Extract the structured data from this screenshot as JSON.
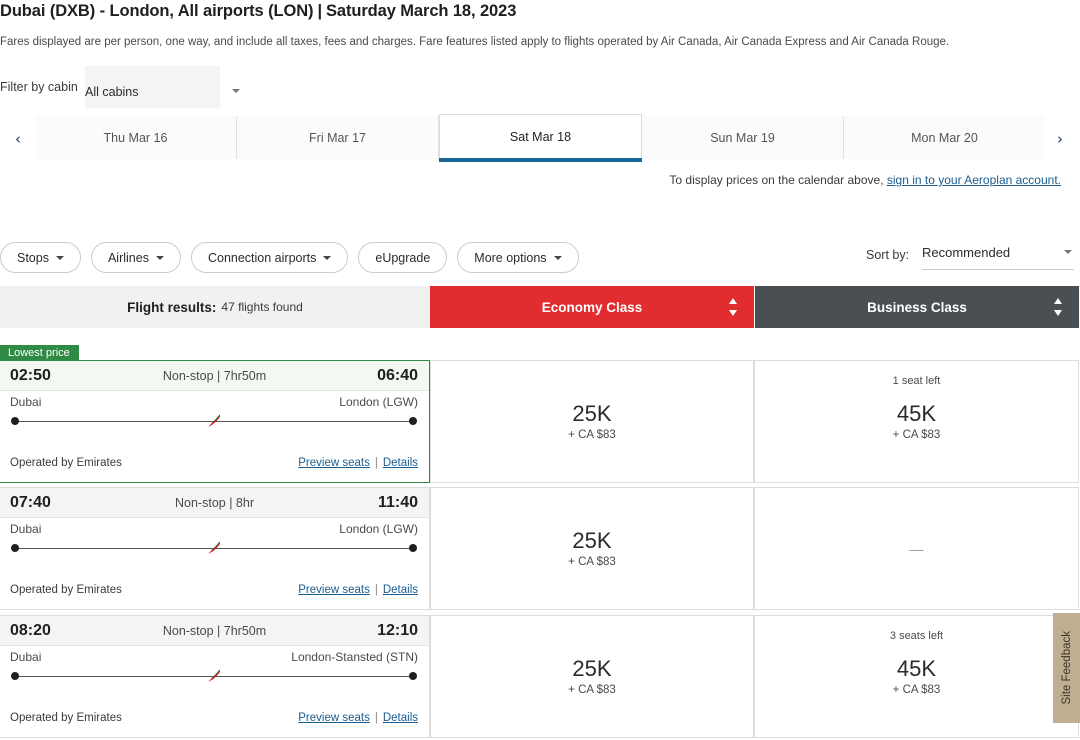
{
  "header": {
    "route": "Dubai (DXB) - London, All airports (LON)",
    "separator": "|",
    "date": "Saturday March 18, 2023",
    "fare_note": "Fares displayed are per person, one way, and include all taxes, fees and charges. Fare features listed apply to flights operated by Air Canada, Air Canada Express and Air Canada Rouge."
  },
  "cabin_filter": {
    "label": "Filter by cabin",
    "value": "All cabins"
  },
  "date_strip": {
    "prev_icon": "‹",
    "next_icon": "›",
    "tabs": [
      {
        "label": "Thu Mar 16",
        "active": false
      },
      {
        "label": "Fri Mar 17",
        "active": false
      },
      {
        "label": "Sat Mar 18",
        "active": true
      },
      {
        "label": "Sun Mar 19",
        "active": false
      },
      {
        "label": "Mon Mar 20",
        "active": false
      }
    ],
    "signin_prefix": "To display prices on the calendar above, ",
    "signin_link": "sign in to your Aeroplan account."
  },
  "filters": {
    "pills": [
      {
        "label": "Stops",
        "caret": true
      },
      {
        "label": "Airlines",
        "caret": true
      },
      {
        "label": "Connection airports",
        "caret": true
      },
      {
        "label": "eUpgrade",
        "caret": false
      },
      {
        "label": "More options",
        "caret": true
      }
    ],
    "sort_label": "Sort by:",
    "sort_value": "Recommended"
  },
  "results_bar": {
    "results_label": "Flight results:",
    "results_count": "47 flights found",
    "economy_label": "Economy Class",
    "business_label": "Business Class"
  },
  "colors": {
    "economy_red": "#e22d30",
    "business_gray": "#4a4f54",
    "lowest_green": "#2f8a43",
    "tab_blue": "#1a6496",
    "link_blue": "#1a5d8f",
    "feedback_tan": "#c0ae93"
  },
  "flights": [
    {
      "badge": "Lowest price",
      "lowest": true,
      "depart_time": "02:50",
      "duration": "Non-stop | 7hr50m",
      "arrive_time": "06:40",
      "from_city": "Dubai",
      "to_city": "London (LGW)",
      "operated_by": "Operated by Emirates",
      "preview_seats": "Preview seats",
      "details": "Details",
      "economy": {
        "seats_left": "",
        "points": "25K",
        "tax": "+ CA $83",
        "available": true
      },
      "business": {
        "seats_left": "1 seat left",
        "points": "45K",
        "tax": "+ CA $83",
        "available": true
      }
    },
    {
      "badge": "",
      "lowest": false,
      "depart_time": "07:40",
      "duration": "Non-stop | 8hr",
      "arrive_time": "11:40",
      "from_city": "Dubai",
      "to_city": "London (LGW)",
      "operated_by": "Operated by Emirates",
      "preview_seats": "Preview seats",
      "details": "Details",
      "economy": {
        "seats_left": "",
        "points": "25K",
        "tax": "+ CA $83",
        "available": true
      },
      "business": {
        "seats_left": "",
        "points": "—",
        "tax": "",
        "available": false
      }
    },
    {
      "badge": "",
      "lowest": false,
      "depart_time": "08:20",
      "duration": "Non-stop | 7hr50m",
      "arrive_time": "12:10",
      "from_city": "Dubai",
      "to_city": "London-Stansted (STN)",
      "operated_by": "Operated by Emirates",
      "preview_seats": "Preview seats",
      "details": "Details",
      "economy": {
        "seats_left": "",
        "points": "25K",
        "tax": "+ CA $83",
        "available": true
      },
      "business": {
        "seats_left": "3 seats left",
        "points": "45K",
        "tax": "+ CA $83",
        "available": true
      }
    }
  ],
  "site_feedback": {
    "label": "Site Feedback"
  }
}
